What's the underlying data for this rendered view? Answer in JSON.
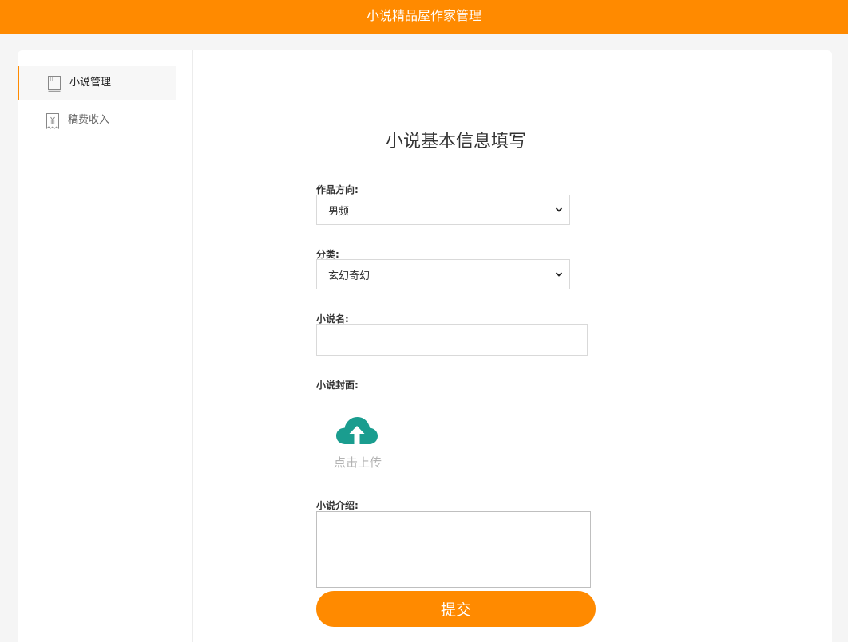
{
  "header": {
    "title": "小说精品屋作家管理"
  },
  "sidebar": {
    "items": [
      {
        "label": "小说管理",
        "icon": "book-icon",
        "active": true
      },
      {
        "label": "稿费收入",
        "icon": "receipt-yen-icon",
        "active": false
      }
    ]
  },
  "form": {
    "title": "小说基本信息填写",
    "direction": {
      "label": "作品方向:",
      "value": "男频"
    },
    "category": {
      "label": "分类:",
      "value": "玄幻奇幻"
    },
    "name": {
      "label": "小说名:",
      "value": "",
      "placeholder": ""
    },
    "cover": {
      "label": "小说封面:",
      "upload_label": "点击上传",
      "icon": "cloud-upload-icon",
      "icon_color": "#1a9d8f"
    },
    "intro": {
      "label": "小说介绍:",
      "value": ""
    },
    "submit_label": "提交"
  },
  "colors": {
    "accent": "#ff8a00",
    "upload_icon": "#1a9d8f"
  }
}
